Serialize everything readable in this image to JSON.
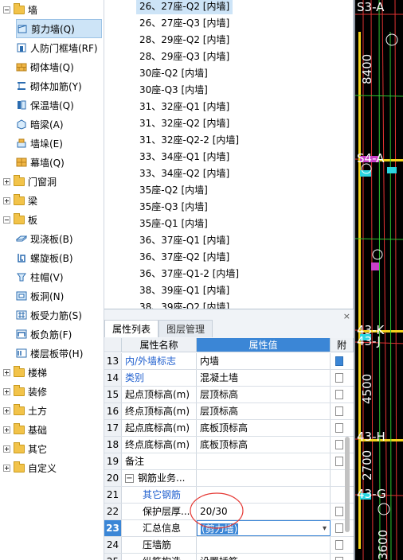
{
  "tree": {
    "items": [
      {
        "label": "墙",
        "type": "group",
        "expanded": true,
        "icon": "folder-icon"
      },
      {
        "label": "剪力墙(Q)",
        "type": "leaf",
        "selected": true,
        "icon": "shear-wall-icon"
      },
      {
        "label": "人防门框墙(RF)",
        "type": "leaf",
        "icon": "door-frame-wall-icon"
      },
      {
        "label": "砌体墙(Q)",
        "type": "leaf",
        "icon": "masonry-wall-icon"
      },
      {
        "label": "砌体加筋(Y)",
        "type": "leaf",
        "icon": "masonry-rebar-icon"
      },
      {
        "label": "保温墙(Q)",
        "type": "leaf",
        "icon": "insulation-wall-icon"
      },
      {
        "label": "暗梁(A)",
        "type": "leaf",
        "icon": "hidden-beam-icon"
      },
      {
        "label": "墙垛(E)",
        "type": "leaf",
        "icon": "wall-pier-icon"
      },
      {
        "label": "幕墙(Q)",
        "type": "leaf",
        "icon": "curtain-wall-icon"
      },
      {
        "label": "门窗洞",
        "type": "group",
        "expanded": false,
        "icon": "folder-icon"
      },
      {
        "label": "梁",
        "type": "group",
        "expanded": false,
        "icon": "folder-icon"
      },
      {
        "label": "板",
        "type": "group",
        "expanded": true,
        "icon": "folder-icon"
      },
      {
        "label": "现浇板(B)",
        "type": "leaf",
        "icon": "cast-slab-icon"
      },
      {
        "label": "螺旋板(B)",
        "type": "leaf",
        "icon": "spiral-slab-icon"
      },
      {
        "label": "柱帽(V)",
        "type": "leaf",
        "icon": "column-cap-icon"
      },
      {
        "label": "板洞(N)",
        "type": "leaf",
        "icon": "slab-hole-icon"
      },
      {
        "label": "板受力筋(S)",
        "type": "leaf",
        "icon": "slab-main-rebar-icon"
      },
      {
        "label": "板负筋(F)",
        "type": "leaf",
        "icon": "slab-negative-rebar-icon"
      },
      {
        "label": "楼层板带(H)",
        "type": "leaf",
        "icon": "slab-strip-icon"
      },
      {
        "label": "楼梯",
        "type": "group",
        "expanded": false,
        "icon": "folder-icon"
      },
      {
        "label": "装修",
        "type": "group",
        "expanded": false,
        "icon": "folder-icon"
      },
      {
        "label": "土方",
        "type": "group",
        "expanded": false,
        "icon": "folder-icon"
      },
      {
        "label": "基础",
        "type": "group",
        "expanded": false,
        "icon": "folder-icon"
      },
      {
        "label": "其它",
        "type": "group",
        "expanded": false,
        "icon": "folder-icon"
      },
      {
        "label": "自定义",
        "type": "group",
        "expanded": false,
        "icon": "folder-icon"
      }
    ]
  },
  "list": {
    "items": [
      "26、27座-Q2 [内墙]",
      "26、27座-Q3 [内墙]",
      "28、29座-Q2 [内墙]",
      "28、29座-Q3 [内墙]",
      "30座-Q2 [内墙]",
      "30座-Q3 [内墙]",
      "31、32座-Q1 [内墙]",
      "31、32座-Q2 [内墙]",
      "31、32座-Q2-2 [内墙]",
      "33、34座-Q1 [内墙]",
      "33、34座-Q2 [内墙]",
      "35座-Q2 [内墙]",
      "35座-Q3 [内墙]",
      "35座-Q1 [内墙]",
      "36、37座-Q1 [内墙]",
      "36、37座-Q2 [内墙]",
      "36、37座-Q1-2 [内墙]",
      "38、39座-Q1 [内墙]",
      "38、39座-Q2 [内墙]"
    ],
    "selected_index": 0
  },
  "props": {
    "close_glyph": "×",
    "tabs": [
      "属性列表",
      "图层管理"
    ],
    "active_tab": 0,
    "col_name": "属性名称",
    "col_value": "属性值",
    "col_extra": "附",
    "rows": [
      {
        "num": "13",
        "name": "内/外墙标志",
        "value": "内墙",
        "name_style": "blue",
        "check": "on"
      },
      {
        "num": "14",
        "name": "类别",
        "value": "混凝土墙",
        "name_style": "blue",
        "check": "off"
      },
      {
        "num": "15",
        "name": "起点顶标高(m)",
        "value": "层顶标高",
        "check": "off"
      },
      {
        "num": "16",
        "name": "终点顶标高(m)",
        "value": "层顶标高",
        "check": "off"
      },
      {
        "num": "17",
        "name": "起点底标高(m)",
        "value": "底板顶标高",
        "check": "off"
      },
      {
        "num": "18",
        "name": "终点底标高(m)",
        "value": "底板顶标高",
        "check": "off"
      },
      {
        "num": "19",
        "name": "备注",
        "value": "",
        "check": "off"
      },
      {
        "num": "20",
        "name": "钢筋业务...",
        "value": "",
        "group": true
      },
      {
        "num": "21",
        "name": "其它钢筋",
        "value": "",
        "name_style": "blue",
        "indent": true
      },
      {
        "num": "22",
        "name": "保护层厚...",
        "value": "20/30",
        "indent": true,
        "check": "off"
      },
      {
        "num": "23",
        "name": "汇总信息",
        "value": "(剪力墙)",
        "indent": true,
        "current": true,
        "check": "off"
      },
      {
        "num": "24",
        "name": "压墙筋",
        "value": "",
        "indent": true,
        "check": "off"
      },
      {
        "num": "25",
        "name": "纵筋构造",
        "value": "设置插筋",
        "indent": true,
        "check": "off"
      }
    ],
    "group_toggle": "−",
    "dropdown_glyph": "▾"
  },
  "cad": {
    "labels": [
      "S3-A",
      "8400",
      "S4-A",
      "43-K",
      "43-J",
      "4500",
      "43-H",
      "2700",
      "43-G",
      "3600"
    ]
  },
  "colors": {
    "selection": "#cde4f7",
    "current_row": "#3b86d6",
    "link_blue": "#1f5fcf",
    "cad_background": "#000000",
    "annotation_circle": "#e53935"
  }
}
